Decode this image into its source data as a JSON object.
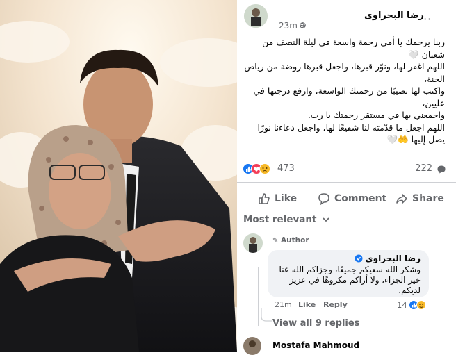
{
  "photo": {
    "description_icon": "portrait-photo"
  },
  "post": {
    "author": "رضا البحراوى",
    "time": "23m",
    "more_label": "···",
    "lines": [
      "ربنا يرحمك يا أمي رحمة واسعة في ليلة النصف من شعبان 🤍",
      "اللهم اغفر لها، ونوّر قبرها، واجعل قبرها روضة من رياض الجنة،",
      "واكتب لها نصيبًا من رحمتك الواسعة، وارفع درجتها في عليين،",
      "واجمعني بها في مستقر رحمتك يا رب.",
      "اللهم اجعل ما قدّمته لنا شفيعًا لها، واجعل دعاءنا نورًا يصل إليها 🤲🤍"
    ]
  },
  "stats": {
    "reactions": "473",
    "comments": "222",
    "reaction_icons": [
      "like-icon",
      "love-icon",
      "sad-icon"
    ]
  },
  "actions": {
    "like": "Like",
    "comment": "Comment",
    "share": "Share"
  },
  "comments": {
    "sort_label": "Most relevant",
    "items": [
      {
        "badge": "Author",
        "name": "رضا البحراوى",
        "text": "وشكر الله سعيكم جميعًا، وجزاكم الله عنا خير الجزاء، ولا أراكم مكروهًا في عزيز لديكم.",
        "time": "21m",
        "like": "Like",
        "reply": "Reply",
        "reactions": "14"
      }
    ],
    "view_all": "View all 9 replies",
    "next_name": "Mostafa Mahmoud"
  },
  "colors": {
    "accent": "#1877f2",
    "muted": "#65676b",
    "bubble": "#f0f2f5"
  }
}
